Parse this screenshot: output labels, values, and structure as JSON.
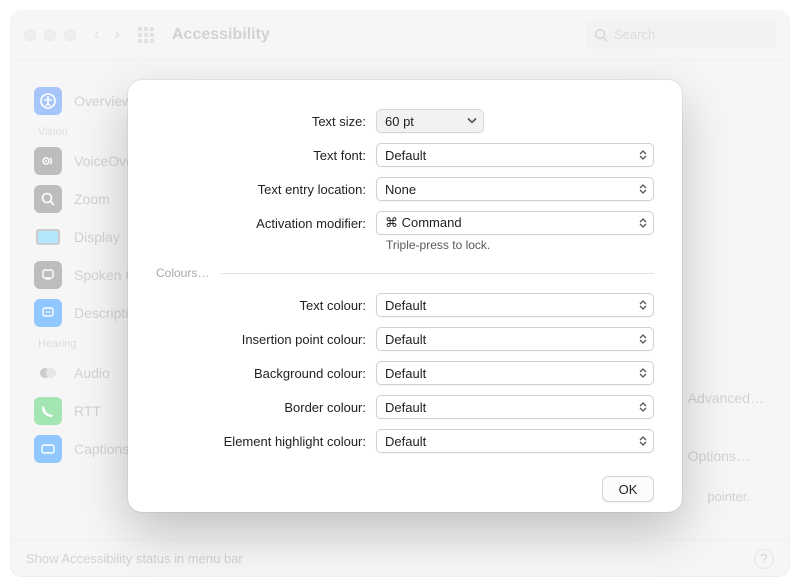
{
  "window": {
    "title": "Accessibility",
    "search_placeholder": "Search"
  },
  "sidebar": {
    "top_item": {
      "label": "Overview"
    },
    "section_vision": {
      "title": "Vision",
      "items": [
        {
          "label": "VoiceOver"
        },
        {
          "label": "Zoom"
        },
        {
          "label": "Display"
        },
        {
          "label": "Spoken Content"
        },
        {
          "label": "Descriptions"
        }
      ]
    },
    "section_hearing": {
      "title": "Hearing",
      "items": [
        {
          "label": "Audio"
        },
        {
          "label": "RTT"
        },
        {
          "label": "Captions"
        }
      ]
    }
  },
  "footer": {
    "label": "Show Accessibility status in menu bar"
  },
  "bg_right": {
    "btn1": "Advanced…",
    "btn2": "Options…",
    "txt": "pointer."
  },
  "sheet": {
    "rows": {
      "text_size": {
        "label": "Text size:",
        "value": "60 pt"
      },
      "text_font": {
        "label": "Text font:",
        "value": "Default"
      },
      "text_entry": {
        "label": "Text entry location:",
        "value": "None"
      },
      "activation": {
        "label": "Activation modifier:",
        "value": "⌘ Command",
        "note": "Triple-press to lock."
      }
    },
    "group_title": "Colours…",
    "colour_rows": {
      "text": {
        "label": "Text colour:",
        "value": "Default"
      },
      "insertion": {
        "label": "Insertion point colour:",
        "value": "Default"
      },
      "background": {
        "label": "Background colour:",
        "value": "Default"
      },
      "border": {
        "label": "Border colour:",
        "value": "Default"
      },
      "highlight": {
        "label": "Element highlight colour:",
        "value": "Default"
      }
    },
    "ok": "OK"
  }
}
